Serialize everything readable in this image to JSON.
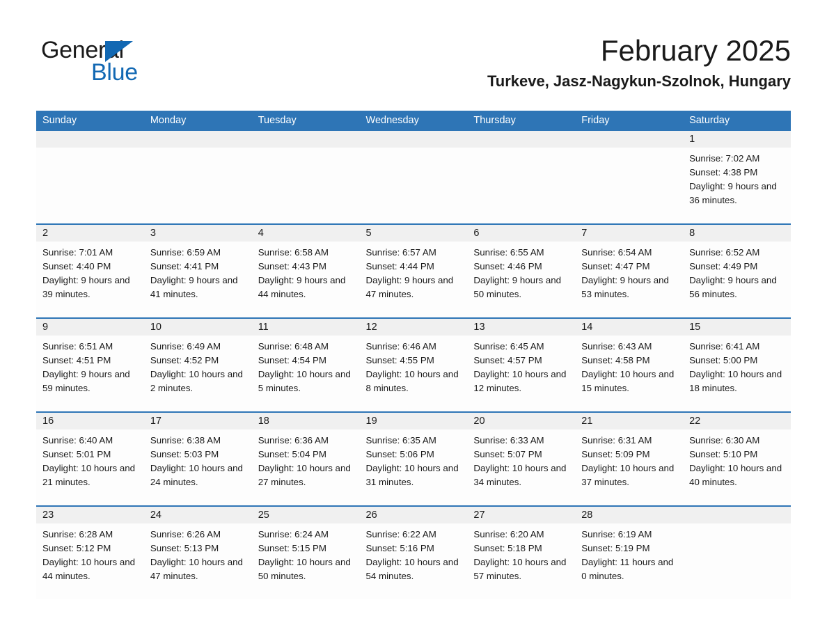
{
  "logo": {
    "word_one": "General",
    "word_two": "Blue",
    "triangle": "triangle-icon",
    "brand_color": "#1268b3"
  },
  "header": {
    "month_title": "February 2025",
    "location": "Turkeve, Jasz-Nagykun-Szolnok, Hungary"
  },
  "theme": {
    "header_blue": "#2E75B6",
    "daynum_band": "#f0f0f0",
    "cell_background": "#fdfdfd",
    "text": "#1a1a1a"
  },
  "calendar": {
    "weekday_headers": [
      "Sunday",
      "Monday",
      "Tuesday",
      "Wednesday",
      "Thursday",
      "Friday",
      "Saturday"
    ],
    "weeks": [
      [
        {
          "day": "",
          "sunrise": "",
          "sunset": "",
          "daylight": ""
        },
        {
          "day": "",
          "sunrise": "",
          "sunset": "",
          "daylight": ""
        },
        {
          "day": "",
          "sunrise": "",
          "sunset": "",
          "daylight": ""
        },
        {
          "day": "",
          "sunrise": "",
          "sunset": "",
          "daylight": ""
        },
        {
          "day": "",
          "sunrise": "",
          "sunset": "",
          "daylight": ""
        },
        {
          "day": "",
          "sunrise": "",
          "sunset": "",
          "daylight": ""
        },
        {
          "day": "1",
          "sunrise": "Sunrise: 7:02 AM",
          "sunset": "Sunset: 4:38 PM",
          "daylight": "Daylight: 9 hours and 36 minutes."
        }
      ],
      [
        {
          "day": "2",
          "sunrise": "Sunrise: 7:01 AM",
          "sunset": "Sunset: 4:40 PM",
          "daylight": "Daylight: 9 hours and 39 minutes."
        },
        {
          "day": "3",
          "sunrise": "Sunrise: 6:59 AM",
          "sunset": "Sunset: 4:41 PM",
          "daylight": "Daylight: 9 hours and 41 minutes."
        },
        {
          "day": "4",
          "sunrise": "Sunrise: 6:58 AM",
          "sunset": "Sunset: 4:43 PM",
          "daylight": "Daylight: 9 hours and 44 minutes."
        },
        {
          "day": "5",
          "sunrise": "Sunrise: 6:57 AM",
          "sunset": "Sunset: 4:44 PM",
          "daylight": "Daylight: 9 hours and 47 minutes."
        },
        {
          "day": "6",
          "sunrise": "Sunrise: 6:55 AM",
          "sunset": "Sunset: 4:46 PM",
          "daylight": "Daylight: 9 hours and 50 minutes."
        },
        {
          "day": "7",
          "sunrise": "Sunrise: 6:54 AM",
          "sunset": "Sunset: 4:47 PM",
          "daylight": "Daylight: 9 hours and 53 minutes."
        },
        {
          "day": "8",
          "sunrise": "Sunrise: 6:52 AM",
          "sunset": "Sunset: 4:49 PM",
          "daylight": "Daylight: 9 hours and 56 minutes."
        }
      ],
      [
        {
          "day": "9",
          "sunrise": "Sunrise: 6:51 AM",
          "sunset": "Sunset: 4:51 PM",
          "daylight": "Daylight: 9 hours and 59 minutes."
        },
        {
          "day": "10",
          "sunrise": "Sunrise: 6:49 AM",
          "sunset": "Sunset: 4:52 PM",
          "daylight": "Daylight: 10 hours and 2 minutes."
        },
        {
          "day": "11",
          "sunrise": "Sunrise: 6:48 AM",
          "sunset": "Sunset: 4:54 PM",
          "daylight": "Daylight: 10 hours and 5 minutes."
        },
        {
          "day": "12",
          "sunrise": "Sunrise: 6:46 AM",
          "sunset": "Sunset: 4:55 PM",
          "daylight": "Daylight: 10 hours and 8 minutes."
        },
        {
          "day": "13",
          "sunrise": "Sunrise: 6:45 AM",
          "sunset": "Sunset: 4:57 PM",
          "daylight": "Daylight: 10 hours and 12 minutes."
        },
        {
          "day": "14",
          "sunrise": "Sunrise: 6:43 AM",
          "sunset": "Sunset: 4:58 PM",
          "daylight": "Daylight: 10 hours and 15 minutes."
        },
        {
          "day": "15",
          "sunrise": "Sunrise: 6:41 AM",
          "sunset": "Sunset: 5:00 PM",
          "daylight": "Daylight: 10 hours and 18 minutes."
        }
      ],
      [
        {
          "day": "16",
          "sunrise": "Sunrise: 6:40 AM",
          "sunset": "Sunset: 5:01 PM",
          "daylight": "Daylight: 10 hours and 21 minutes."
        },
        {
          "day": "17",
          "sunrise": "Sunrise: 6:38 AM",
          "sunset": "Sunset: 5:03 PM",
          "daylight": "Daylight: 10 hours and 24 minutes."
        },
        {
          "day": "18",
          "sunrise": "Sunrise: 6:36 AM",
          "sunset": "Sunset: 5:04 PM",
          "daylight": "Daylight: 10 hours and 27 minutes."
        },
        {
          "day": "19",
          "sunrise": "Sunrise: 6:35 AM",
          "sunset": "Sunset: 5:06 PM",
          "daylight": "Daylight: 10 hours and 31 minutes."
        },
        {
          "day": "20",
          "sunrise": "Sunrise: 6:33 AM",
          "sunset": "Sunset: 5:07 PM",
          "daylight": "Daylight: 10 hours and 34 minutes."
        },
        {
          "day": "21",
          "sunrise": "Sunrise: 6:31 AM",
          "sunset": "Sunset: 5:09 PM",
          "daylight": "Daylight: 10 hours and 37 minutes."
        },
        {
          "day": "22",
          "sunrise": "Sunrise: 6:30 AM",
          "sunset": "Sunset: 5:10 PM",
          "daylight": "Daylight: 10 hours and 40 minutes."
        }
      ],
      [
        {
          "day": "23",
          "sunrise": "Sunrise: 6:28 AM",
          "sunset": "Sunset: 5:12 PM",
          "daylight": "Daylight: 10 hours and 44 minutes."
        },
        {
          "day": "24",
          "sunrise": "Sunrise: 6:26 AM",
          "sunset": "Sunset: 5:13 PM",
          "daylight": "Daylight: 10 hours and 47 minutes."
        },
        {
          "day": "25",
          "sunrise": "Sunrise: 6:24 AM",
          "sunset": "Sunset: 5:15 PM",
          "daylight": "Daylight: 10 hours and 50 minutes."
        },
        {
          "day": "26",
          "sunrise": "Sunrise: 6:22 AM",
          "sunset": "Sunset: 5:16 PM",
          "daylight": "Daylight: 10 hours and 54 minutes."
        },
        {
          "day": "27",
          "sunrise": "Sunrise: 6:20 AM",
          "sunset": "Sunset: 5:18 PM",
          "daylight": "Daylight: 10 hours and 57 minutes."
        },
        {
          "day": "28",
          "sunrise": "Sunrise: 6:19 AM",
          "sunset": "Sunset: 5:19 PM",
          "daylight": "Daylight: 11 hours and 0 minutes."
        },
        {
          "day": "",
          "sunrise": "",
          "sunset": "",
          "daylight": ""
        }
      ]
    ]
  }
}
